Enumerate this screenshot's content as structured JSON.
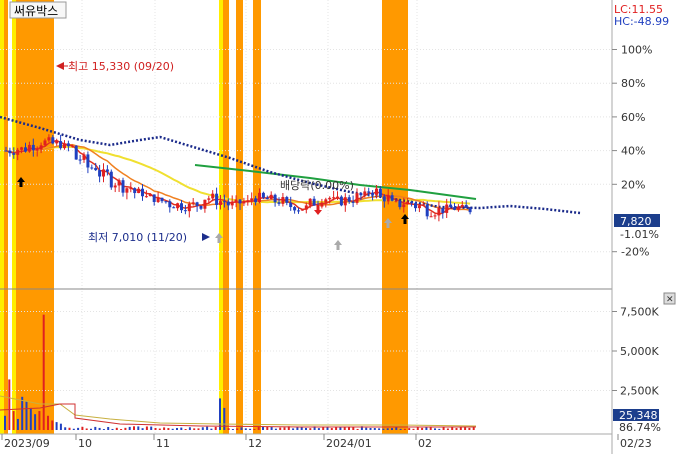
{
  "stock_name": "써유박스",
  "indicators": {
    "lc": "LC:11.55",
    "hc": "HC:-48.99"
  },
  "price_axis": {
    "ticks": [
      "100%",
      "80%",
      "60%",
      "40%",
      "20%",
      "-20%"
    ],
    "tick_values": [
      100,
      80,
      60,
      40,
      20,
      -20
    ]
  },
  "current": {
    "price": "7,820",
    "change": "-1.01%",
    "price_pct": 0
  },
  "volume_axis": {
    "ticks": [
      "7,500K",
      "5,000K",
      "2,500K"
    ],
    "tick_values": [
      7500,
      5000,
      2500
    ]
  },
  "current_volume": {
    "value": "25,348",
    "ratio": "86.74%"
  },
  "x_axis": {
    "labels": [
      "2023/09",
      "10",
      "11",
      "12",
      "2024/01",
      "02",
      "02/23"
    ]
  },
  "annotations": {
    "high": "최고 15,330 (09/20)",
    "low": "최저 7,010 (11/20)",
    "dividend": "배당락(0.00%)"
  },
  "colors": {
    "highlight_orange": "#ff9900",
    "highlight_yellow": "#ffee00",
    "candle_up": "#e02020",
    "candle_down": "#2040c0",
    "ma_yellow": "#f0e030",
    "ma_orange": "#f08020",
    "ma_red": "#e03020",
    "ma_green": "#20a040",
    "ma_dotted": "#1a2a8a",
    "axis_text": "#333333",
    "lc_text": "#e02020",
    "hc_text": "#2040c0"
  },
  "chart_data": {
    "type": "line",
    "series": [
      {
        "values": [
          40,
          41,
          43,
          45,
          44,
          42,
          35,
          30,
          26,
          21,
          18,
          15,
          12,
          10,
          8,
          7,
          8,
          12,
          10,
          8,
          9,
          12,
          11,
          10,
          7,
          6,
          9,
          12,
          10,
          11,
          13,
          16,
          12,
          8,
          9,
          7,
          4,
          5,
          6,
          5
        ]
      }
    ],
    "categories": [
      "2023/09",
      "10",
      "11",
      "12",
      "2024/01",
      "02"
    ]
  }
}
